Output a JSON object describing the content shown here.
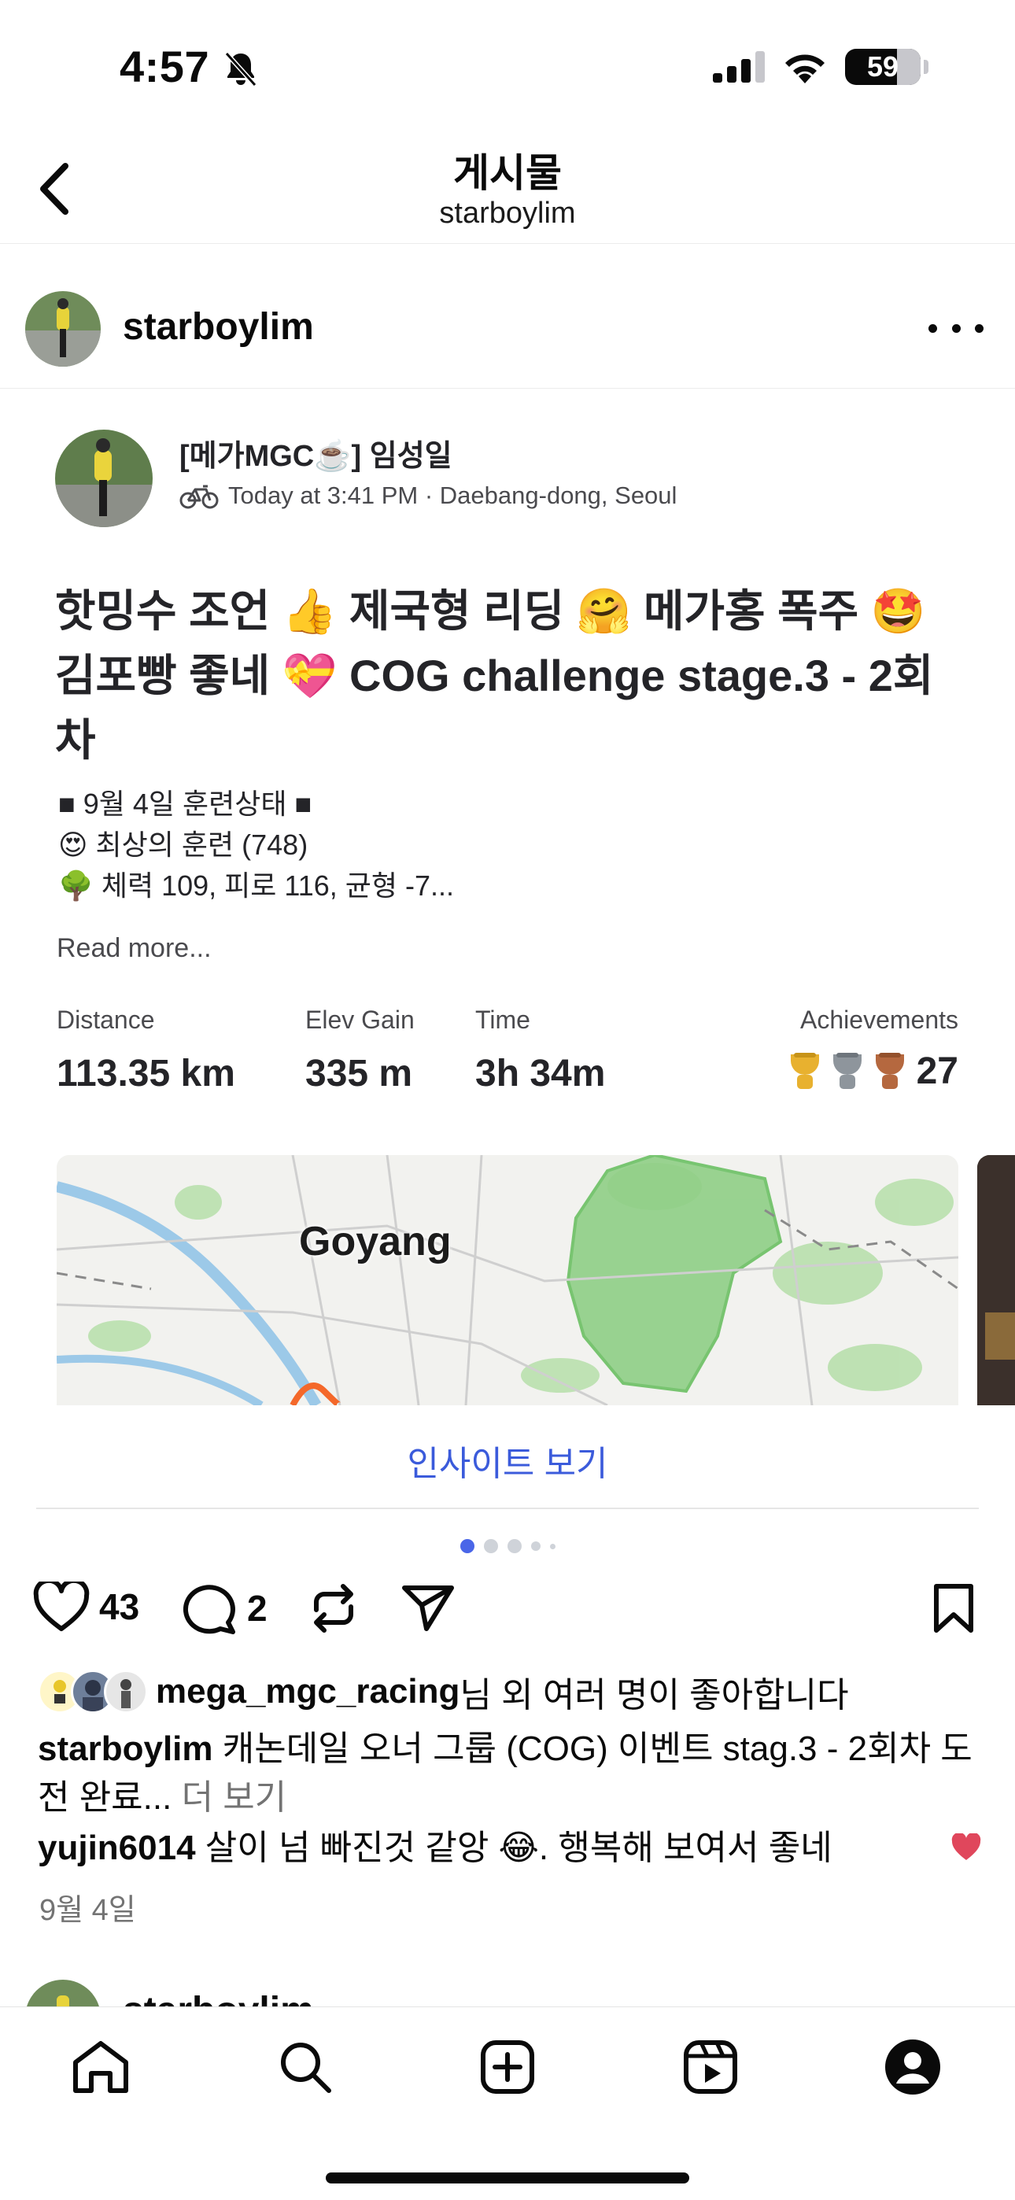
{
  "status_bar": {
    "time": "4:57",
    "battery": "59"
  },
  "nav": {
    "title": "게시물",
    "subtitle": "starboylim"
  },
  "post": {
    "username": "starboylim"
  },
  "activity": {
    "athlete": "[메가MGC☕️] 임성일",
    "meta": "Today at 3:41 PM · Daebang-dong, Seoul",
    "title": "핫밍수 조언 👍 제국형 리딩 🤗 메가홍 폭주 🤩 김포빵 좋네 💝  COG challenge stage.3 - 2회차",
    "desc": [
      "■ 9월 4일 훈련상태 ■",
      "😍 최상의 훈련 (748)",
      "🌳 체력 109, 피로 116, 균형 -7..."
    ],
    "read_more": "Read more...",
    "stats": [
      {
        "label": "Distance",
        "value": "113.35 km"
      },
      {
        "label": "Elev Gain",
        "value": "335 m"
      },
      {
        "label": "Time",
        "value": "3h 34m"
      }
    ],
    "achievements_label": "Achievements",
    "achievements_count": "27",
    "trophy_colors": [
      "#e8b12f",
      "#8e959c",
      "#b5683f"
    ],
    "map_label": "Goyang",
    "insight_link": "인사이트 보기"
  },
  "carousel": {
    "active_index": 0
  },
  "actions": {
    "like_count": "43",
    "comment_count": "2"
  },
  "likes": {
    "user": "mega_mgc_racing",
    "suffix": "님 외 여러 명이 좋아합니다"
  },
  "caption": {
    "user": "starboylim",
    "text": " 캐논데일 오너 그룹 (COG) 이벤트 stag.3 - 2회차 도전 완료...",
    "more": " 더 보기"
  },
  "comment": {
    "user": "yujin6014",
    "text": " 살이 넘 빠진것 같앙 😂. 행복해 보여서 좋네"
  },
  "date": "9월 4일",
  "next_post": {
    "username": "starboylim"
  },
  "colors": {
    "accent": "#3b5bdb",
    "heart": "#e0475c",
    "map_green": "#8fcf86"
  }
}
